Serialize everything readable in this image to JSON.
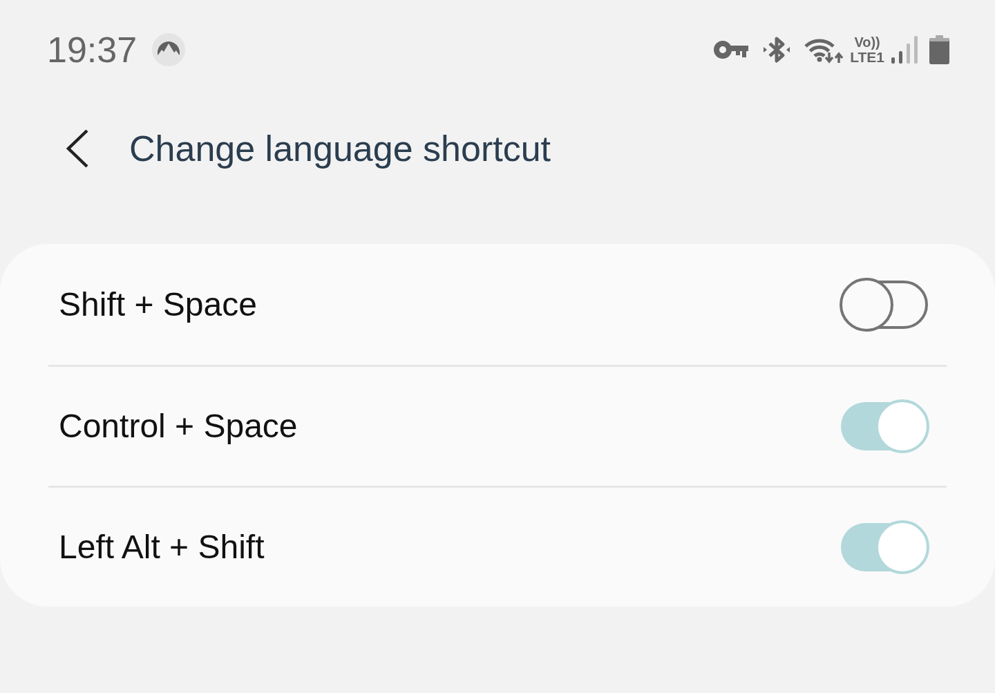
{
  "status_bar": {
    "time": "19:37",
    "call_label": "Vo))",
    "network_label": "LTE1"
  },
  "header": {
    "title": "Change language shortcut"
  },
  "shortcuts": [
    {
      "label": "Shift + Space",
      "on": false
    },
    {
      "label": "Control + Space",
      "on": true
    },
    {
      "label": "Left Alt + Shift",
      "on": true
    }
  ]
}
